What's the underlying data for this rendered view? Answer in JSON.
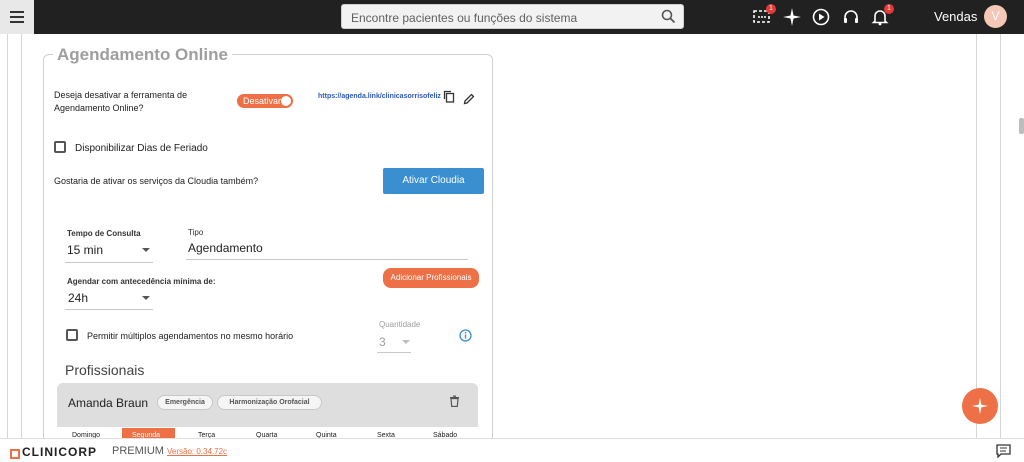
{
  "search": {
    "placeholder": "Encontre pacientes ou funções do sistema"
  },
  "header": {
    "user_name": "Vendas",
    "avatar_initial": "V",
    "notification_badge": "1",
    "task_badge": "1"
  },
  "card": {
    "title": "Agendamento Online",
    "deactivate_question": "Deseja desativar a ferramenta de Agendamento Online?",
    "toggle_label": "Desativar",
    "link": "https://agenda.link/clinicasorrisofeliz",
    "holidays_label": "Disponibilizar Dias de Feriado",
    "cloudia_question": "Gostaria de ativar os serviços da Cloudia também?",
    "cloudia_button": "Ativar Cloudia",
    "consult_time_label": "Tempo de Consulta",
    "consult_time_value": "15 min",
    "type_label": "Tipo",
    "type_value": "Agendamento",
    "add_professionals_button": "Adicionar Profissionais",
    "advance_label": "Agendar com antecedência mínima de:",
    "advance_value": "24h",
    "multiple_label": "Permitir múltiplos agendamentos no mesmo horário",
    "quantity_label": "Quantidade",
    "quantity_value": "3",
    "professionals_title": "Profissionais",
    "professional": {
      "name": "Amanda Braun",
      "tags": [
        "Emergência",
        "Harmonização Orofacial"
      ],
      "days": [
        "Domingo",
        "Segunda",
        "Terça",
        "Quarta",
        "Quinta",
        "Sexta",
        "Sábado"
      ],
      "active_day": "Segunda"
    }
  },
  "footer": {
    "brand": "CLINICORP",
    "plan": "PREMIUM",
    "version": "Versão: 0.34.72c"
  },
  "colors": {
    "accent": "#ee7046",
    "primary_blue": "#3a8fd1",
    "topbar": "#212121"
  }
}
